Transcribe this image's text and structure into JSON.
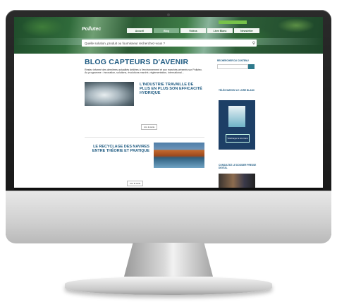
{
  "header": {
    "logo": "Pollutec",
    "logo_sub": "",
    "top_button": "",
    "top_icons": "",
    "nav": [
      "Accueil",
      "Blog",
      "Vidéos",
      "Livre Blanc",
      "Newsletter"
    ],
    "active_nav": 1,
    "search_placeholder": "Quelle solution, produit ou fournisseur recherchez-vous ?"
  },
  "main": {
    "title": "BLOG CAPTEURS D'AVENIR",
    "intro": "Restez informé des dernières actualités dédiées à l'environnement et aux marchés présents sur Pollutec. Au programme : innovation, solutions, évolutions marché, réglementation, international...",
    "articles": [
      {
        "meta": "",
        "title": "L'INDUSTRIE TRAVAILLE DE PLUS EN PLUS SON EFFICACITÉ HYDRIQUE",
        "excerpt": "",
        "read_more": "Lire la suite"
      },
      {
        "meta": "",
        "title": "LE RECYCLAGE DES NAVIRES ENTRE THÉORIE ET PRATIQUE",
        "excerpt": "",
        "read_more": "Lire la suite"
      }
    ]
  },
  "sidebar": {
    "search_heading": "RECHERCHER DU CONTENU",
    "whitepaper_heading": "TÉLÉCHARGEZ LE LIVRE BLANC",
    "whitepaper_button": "Téléchargez le livre blanc",
    "magazine_heading": "CONSULTEZ LE DOSSIER PRESSE DIGITAL"
  },
  "colors": {
    "accent": "#1f5b82",
    "nav_active": "#7fb08a",
    "top_button": "#77c24a"
  }
}
